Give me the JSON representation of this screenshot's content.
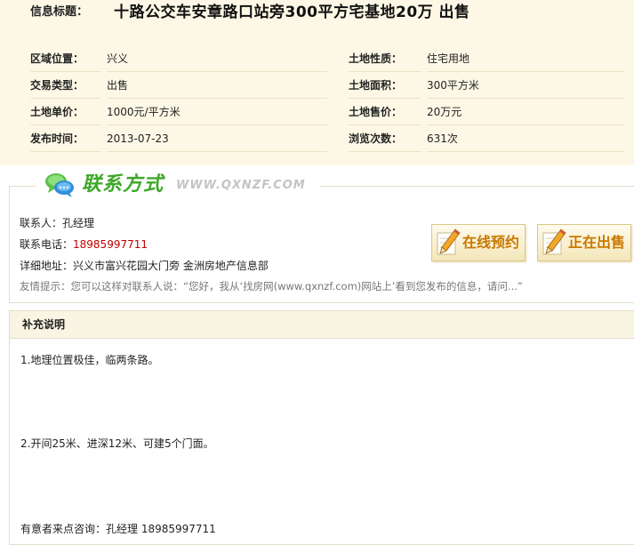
{
  "info": {
    "title_label": "信息标题：",
    "title_value": "十路公交车安章路口站旁300平方宅基地20万  出售",
    "rows": [
      {
        "left_label": "区域位置：",
        "left_value": "兴义",
        "right_label": "土地性质：",
        "right_value": "住宅用地"
      },
      {
        "left_label": "交易类型：",
        "left_value": "出售",
        "right_label": "土地面积：",
        "right_value": "300平方米"
      },
      {
        "left_label": "土地单价：",
        "left_value": "1000元/平方米",
        "right_label": "土地售价：",
        "right_value": "20万元"
      },
      {
        "left_label": "发布时间：",
        "left_value": "2013-07-23",
        "right_label": "浏览次数：",
        "right_value": "631次"
      }
    ]
  },
  "contact": {
    "heading": "联系方式",
    "site": "WWW.QXNZF.COM",
    "person_label": "联系人：",
    "person": "孔经理",
    "phone_label": "联系电话：",
    "phone": "18985997711",
    "address_label": "详细地址：",
    "address": "兴义市富兴花园大门旁 金洲房地产信息部",
    "tip_label": "友情提示：",
    "tip": "您可以这样对联系人说：“您好，我从‘找房网(www.qxnzf.com)网站上’看到您发布的信息，请问...”",
    "buttons": {
      "appointment": "在线预约",
      "status": "正在出售"
    }
  },
  "supplement": {
    "heading": "补充说明",
    "lines": [
      "1.地理位置极佳，临两条路。",
      "2.开间25米、进深12米、可建5个门面。",
      "有意者来点咨询：孔经理 18985997711"
    ]
  },
  "colors": {
    "info_bg": "#fdf8e6",
    "accent_green": "#3ea82a",
    "phone_red": "#c00000",
    "button_text": "#c87800"
  }
}
